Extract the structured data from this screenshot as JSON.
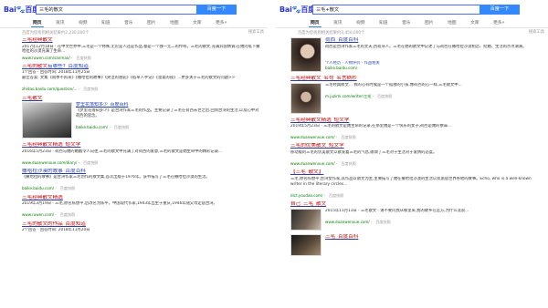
{
  "left": {
    "logo": {
      "a": "Bai",
      "b": "百度"
    },
    "query": "三毛的散文",
    "search_button": "百度一下",
    "tabs": [
      "网页",
      "资讯",
      "视频",
      "知道",
      "音乐",
      "图片",
      "地图",
      "文库",
      "更多»"
    ],
    "count": "百度为您找到相关结果约2,230,000个",
    "tool": "搜索工具",
    "results": [
      {
        "t1": "三毛经典散文",
        "t2": "",
        "d": "2017年12月18日 · 在中文世界中,三毛是一个特殊,无论是人还是作品,都是一个独一无二的传奇。三毛的散文,充满异国情调,在她的笔下撒哈拉的沙漠充满了生命...",
        "u": "www.ruwen.com/sanmao/ ·",
        "s": "百度快照"
      },
      {
        "t1": "三毛的散文",
        "t2": "有哪些?_百度知道",
        "d": "1个回答 · 回答时间: 2018年11月25日",
        "d2": "最佳答案: 文集《雨季不再来》《撒哈拉的故事》《哭泣的骆驼》《稻草人手记》《温柔的夜》...更多关于三毛的散文的问题>>",
        "u": "zhidao.baidu.com/question/... ·",
        "s": "百度快照"
      },
      {
        "t1": "三毛散文",
        "t2": "",
        "d": "",
        "u": "",
        "s": ""
      },
      {
        "t1": "梦里花落知多少_百度百科",
        "t2": "",
        "d": "《梦里花落知多少》是台湾作家三毛的作品。主要记录了三毛在荷西去世之后,回到台湾的生活,以及心中对荷西的思念。",
        "u": "baike.baidu.com/ ·",
        "s": "百度快照"
      },
      {
        "t1": "三毛经典散文精选_短文学",
        "t2": "",
        "d": "2016年5月23日 · 荷西与她的婚姻令人向往,三毛的散文中充满了对荷西的爱意,三毛的散文是她生命中的精彩记录...",
        "u": "www.duanwenxue.com/diary/ ·",
        "s": "百度快照"
      },
      {
        "t1": "撒哈拉沙漠的故事_百度百科",
        "t2": "",
        "d": "《撒哈拉的故事》是台湾作家三毛创作的散文集,首次出版于1976年。该书描写了三毛在撒哈拉沙漠的生活。",
        "u": "baike.baidu.com/ ·",
        "s": "百度快照"
      },
      {
        "t1": "三毛经典散文精选",
        "t2": "",
        "d": "2019年3月19日 · 三毛,原名陈懋平,后改名为陈平。中国现代作家,1943年出生于重庆,1946年随父母定居台湾。",
        "u": "www.ruwen.com/ ·",
        "s": "百度快照"
      },
      {
        "t1": "三毛的散文的作品_百度知道",
        "t2": "",
        "d": "2个回答 · 回答时间: 2018年11月20日",
        "u": "zhidao.baidu.com/ ·",
        "s": "百度快照"
      }
    ]
  },
  "right": {
    "logo": {
      "a": "Bai",
      "b": "百度"
    },
    "query": "三毛+散文",
    "search_button": "百度一下",
    "tabs": [
      "网页",
      "资讯",
      "视频",
      "知道",
      "音乐",
      "图片",
      "地图",
      "文库",
      "更多»"
    ],
    "count": "百度为您找到相关结果约3,450,000个",
    "tool": "搜索工具",
    "results": [
      {
        "t1": "荷西_百度百科",
        "d": "荷西是台湾作家三毛的丈夫,西班牙人。三毛在她的散文中记述了与荷西在撒哈拉沙漠相恋、结婚、生活的点点滴滴。",
        "d2": "个人经历 · 人物评价 · 作品相关",
        "u": "baike.baidu.com/ ·"
      },
      {
        "t1": "三毛经典散文_名句_名言摘抄",
        "d": "三毛经典散文... 我的心有时候是一个孤独的小孩,像荷西的心一样,三毛散文中...",
        "u": "m.juzimi.com/writer/三毛 ·",
        "s": "百度快照"
      },
      {
        "t1": "三毛经典散文精选_短文学",
        "d": "2019年5月23日 · 三毛的散文是她生命的记录,在那里她是一个快乐的女子,荷西是她的依靠...",
        "u": "www.duanwenxue.com/ ·",
        "s": "百度快照"
      },
      {
        "t1": "三毛的优美散文_短文学",
        "d": "移动版的三毛的优美散文以散发着三毛的气息,歌颂了三毛对于生活对于爱情的态度。",
        "u": "www.duanwenxue.com/ ·",
        "s": "百度快照"
      },
      {
        "t1": "【三毛_散文】",
        "d": "三毛,原名陈懋平,台湾女作家,其作品以散文为主,主要描写了她在撒哈拉沙漠的生活以及旅居世界各地的故事。Echo, who is a well-known writer in the literary circles...",
        "u": "dict.youdao.com/ ·",
        "s": "百度快照"
      },
      {
        "t1": "自己_三毛_散文",
        "d": "2015年11月13日 · 三毛散文 · 请不要问我从哪里来,我的故乡在远方,为什么流浪...",
        "u": "www.duanwenxue.com/ ·",
        "s": "百度快照"
      },
      {
        "t1": "三毛_百度百科",
        "d": "",
        "u": ""
      }
    ]
  },
  "colors": {
    "link": "#2440b3",
    "em": "#cc0000",
    "url": "#008000",
    "btn": "#3388ff"
  }
}
